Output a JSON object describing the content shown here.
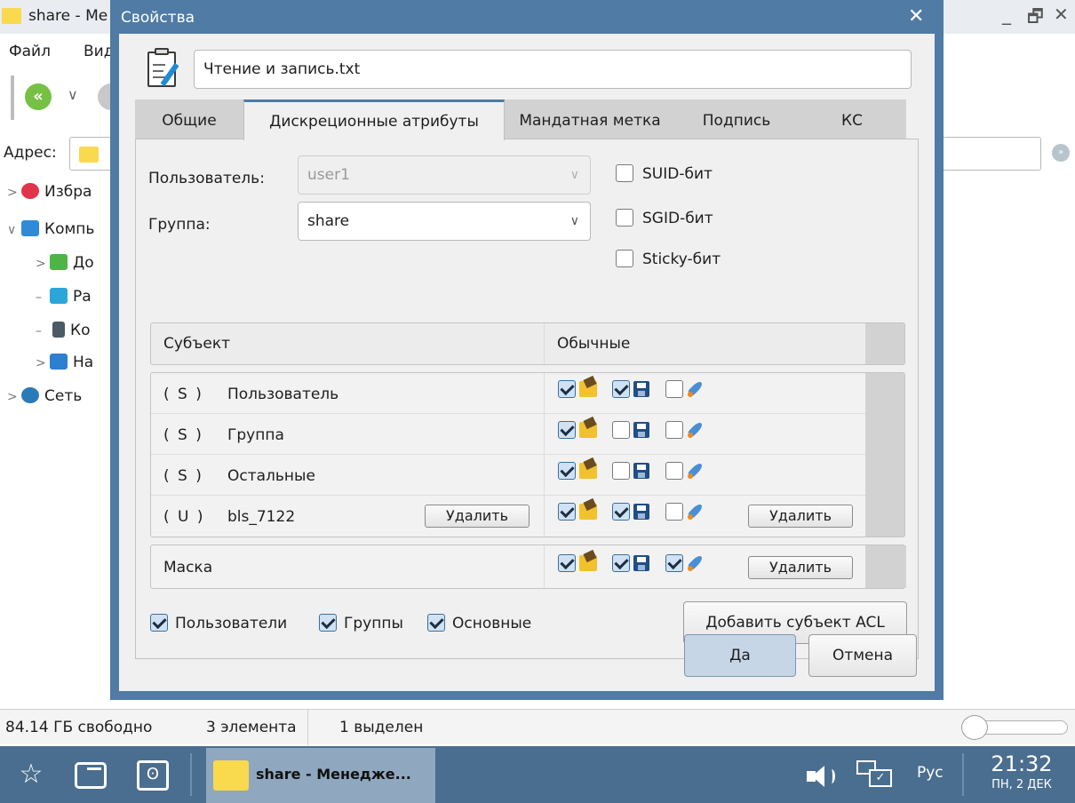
{
  "file_manager": {
    "title": "share - Ме",
    "window_controls": [
      "_",
      "🗗",
      "✕"
    ],
    "menu": [
      "Файл",
      "Вид"
    ],
    "address_label": "Адрес:",
    "tree": [
      {
        "label": "Избра",
        "icon": "heart-icon"
      },
      {
        "label": "Компь",
        "icon": "computer-icon"
      },
      {
        "label": "До",
        "icon": "home-icon"
      },
      {
        "label": "Ра",
        "icon": "desktop-icon"
      },
      {
        "label": "Ко",
        "icon": "trash-icon"
      },
      {
        "label": "На",
        "icon": "settings-icon"
      },
      {
        "label": "Сеть",
        "icon": "network-icon"
      }
    ],
    "status": {
      "free": "84.14 ГБ свободно",
      "count": "3 элемента",
      "selected": "1 выделен"
    }
  },
  "dialog": {
    "title": "Свойства",
    "file_name": "Чтение и запись.txt",
    "tabs": [
      "Общие",
      "Дискреционные атрибуты",
      "Мандатная метка",
      "Подпись",
      "КС"
    ],
    "active_tab": 1,
    "owner_label": "Пользователь:",
    "owner_value": "user1",
    "group_label": "Группа:",
    "group_value": "share",
    "suid_label": "SUID-бит",
    "sgid_label": "SGID-бит",
    "sticky_label": "Sticky-бит",
    "acl_header": {
      "subject": "Субъект",
      "perms": "Обычные"
    },
    "acl_rows": [
      {
        "kind": "( S )",
        "name": "Пользователь",
        "r": true,
        "w": true,
        "x": false
      },
      {
        "kind": "( S )",
        "name": "Группа",
        "r": true,
        "w": false,
        "x": false
      },
      {
        "kind": "( S )",
        "name": "Остальные",
        "r": true,
        "w": false,
        "x": false
      },
      {
        "kind": "( U )",
        "name": "bls_7122",
        "r": true,
        "w": true,
        "x": false
      }
    ],
    "delete_label": "Удалить",
    "mask": {
      "name": "Маска",
      "r": true,
      "w": true,
      "x": true
    },
    "filters": {
      "users": "Пользователи",
      "groups": "Группы",
      "basic": "Основные"
    },
    "add_acl": "Добавить субъект ACL",
    "ok": "Да",
    "cancel": "Отмена"
  },
  "taskbar": {
    "task_label": "share - Менедже...",
    "lang": "Рус",
    "time": "21:32",
    "date": "ПН, 2 ДЕК"
  }
}
